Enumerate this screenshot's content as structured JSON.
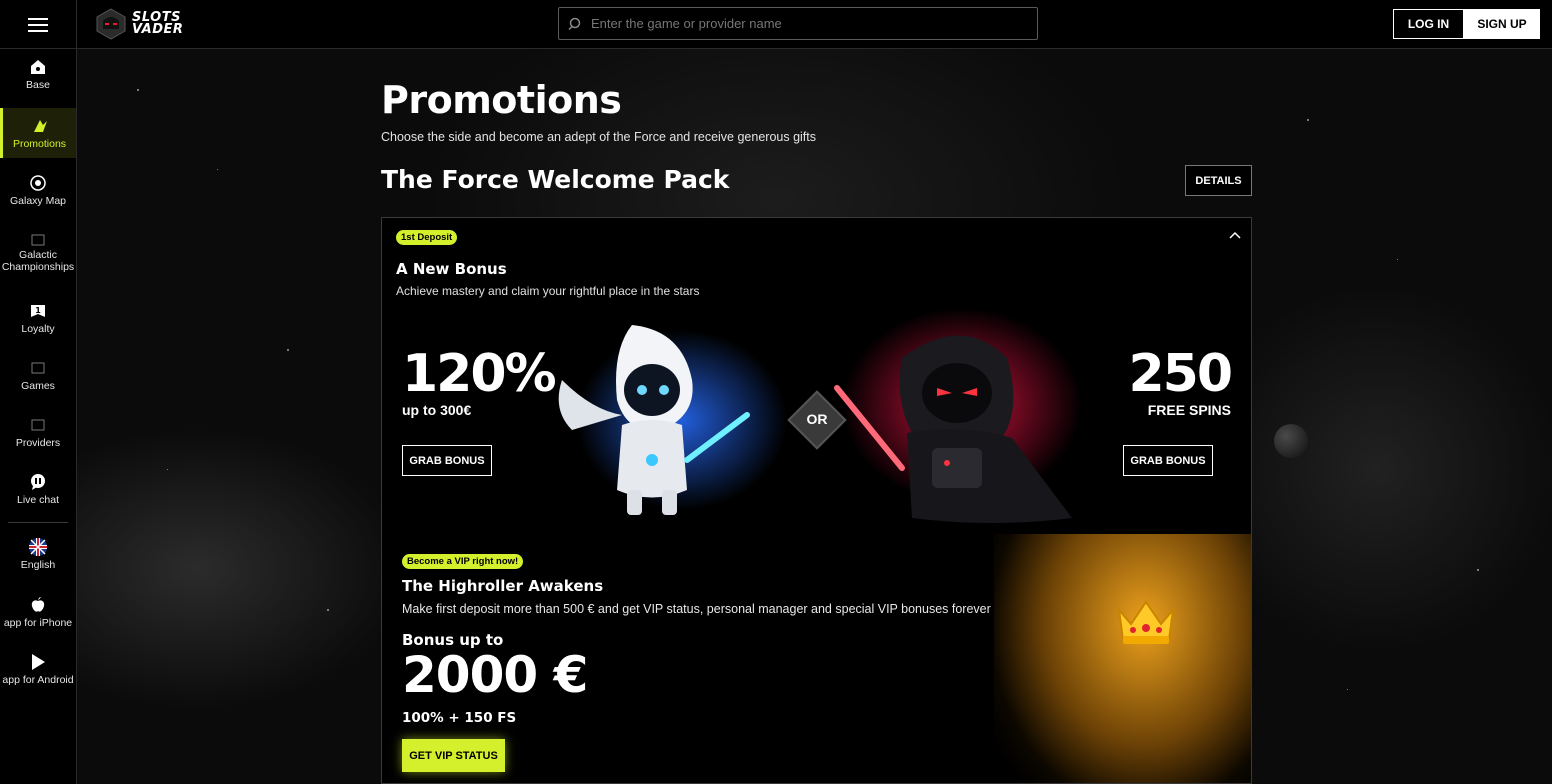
{
  "header": {
    "logo_line1": "SLOTS",
    "logo_line2": "VADER",
    "search_placeholder": "Enter the game or provider name",
    "login_label": "LOG IN",
    "signup_label": "SIGN UP"
  },
  "sidebar": {
    "items": [
      {
        "label": "Base",
        "icon": "home-icon"
      },
      {
        "label": "Promotions",
        "icon": "promotions-icon",
        "active": true
      },
      {
        "label": "Galaxy Map",
        "icon": "galaxy-map-icon"
      },
      {
        "label": "Galactic Championships",
        "icon": "tournament-icon"
      },
      {
        "label": "Loyalty",
        "icon": "loyalty-icon"
      },
      {
        "label": "Games",
        "icon": "games-icon"
      },
      {
        "label": "Providers",
        "icon": "providers-icon"
      },
      {
        "label": "Live chat",
        "icon": "chat-icon"
      },
      {
        "label": "English",
        "icon": "uk-flag-icon"
      },
      {
        "label": "app for iPhone",
        "icon": "apple-icon"
      },
      {
        "label": "app for Android",
        "icon": "google-play-icon"
      }
    ]
  },
  "main": {
    "title": "Promotions",
    "subtitle": "Choose the side and become an adept of the Force and receive generous gifts",
    "section_title": "The Force Welcome Pack",
    "details_label": "DETAILS",
    "bonus": {
      "badge": "1st Deposit",
      "title": "A New Bonus",
      "description": "Achieve mastery and claim your rightful place in the stars",
      "left_value": "120%",
      "left_sub": "up to 300€",
      "or_label": "OR",
      "right_value": "250",
      "right_sub": "FREE SPINS",
      "grab_label": "GRAB BONUS"
    },
    "vip": {
      "badge": "Become a VIP right now!",
      "title": "The Highroller Awakens",
      "description": "Make first deposit more than 500 € and get VIP status, personal manager and special VIP bonuses forever",
      "bonus_label": "Bonus up to",
      "amount": "2000 €",
      "extra": "100% + 150 FS",
      "button_label": "GET VIP STATUS"
    }
  },
  "colors": {
    "accent": "#d4f02c",
    "background": "#000000",
    "blue_glow": "#2e6bff",
    "red_glow": "#f0144a",
    "gold_glow": "#f5a623"
  }
}
